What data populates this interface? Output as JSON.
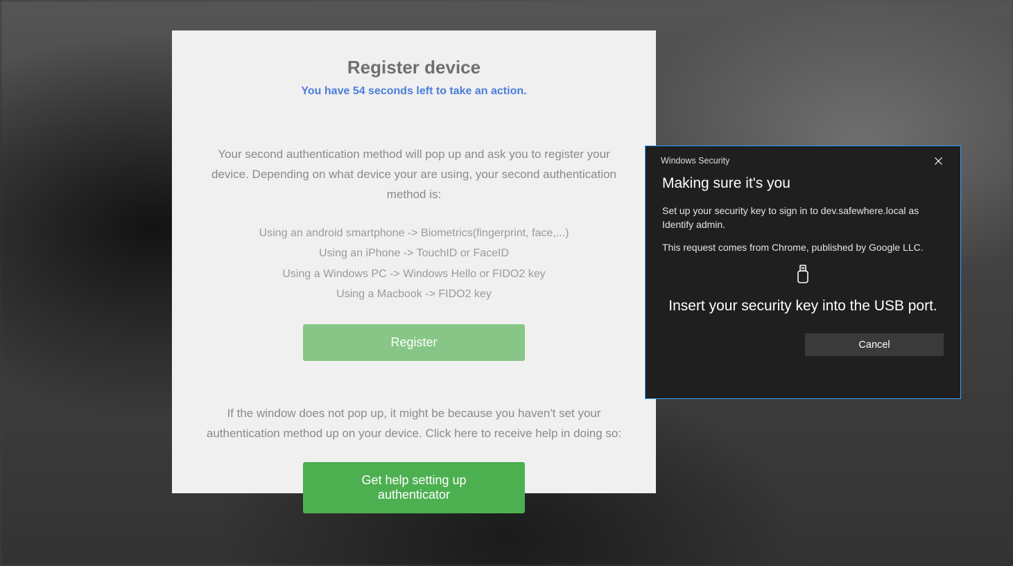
{
  "card": {
    "title": "Register device",
    "countdown": "You have 54 seconds left to take an action.",
    "intro": "Your second authentication method will pop up and ask you to register your device. Depending on what device your are using, your second authentication method is:",
    "method_android": "Using an android smartphone -> Biometrics(fingerprint, face,...)",
    "method_iphone": "Using an iPhone -> TouchID or FaceID",
    "method_windows": "Using a Windows PC -> Windows Hello or FIDO2 key",
    "method_mac": "Using a Macbook -> FIDO2 key",
    "register_label": "Register",
    "fallback_text": "If the window does not pop up, it might be because you haven't set your authentication method up on your device. Click here to receive help in doing so:",
    "help_label": "Get help setting up authenticator"
  },
  "ws": {
    "window_title": "Windows Security",
    "heading": "Making sure it's you",
    "line1": "Set up your security key to sign in to dev.safewhere.local as Identify admin.",
    "line2": "This request comes from Chrome, published by Google LLC.",
    "prompt": "Insert your security key into the USB port.",
    "cancel_label": "Cancel"
  }
}
